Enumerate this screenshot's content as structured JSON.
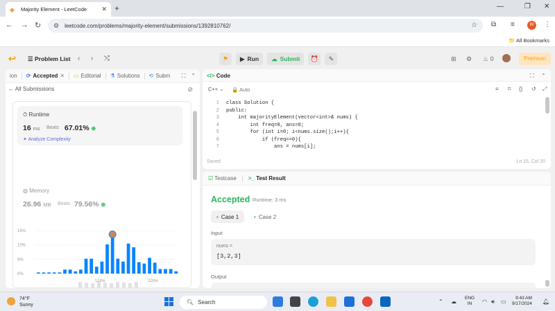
{
  "browser": {
    "tab_title": "Majority Element - LeetCode",
    "url": "leetcode.com/problems/majority-element/submissions/1392810762/",
    "bookmarks_label": "All Bookmarks"
  },
  "nav": {
    "problem_list": "Problem List",
    "run": "Run",
    "submit": "Submit",
    "streak": "0",
    "premium": "Premium"
  },
  "left": {
    "tabs": [
      "ion",
      "Accepted",
      "Editorial",
      "Solutions",
      "Subm"
    ],
    "back_label": "All Submissions",
    "runtime_label": "Runtime",
    "runtime_value": "16",
    "runtime_unit": "ms",
    "beats_label": "Beats",
    "runtime_beats": "67.01%",
    "analyze": "Analyze Complexity",
    "memory_label": "Memory",
    "memory_value": "26.96",
    "memory_unit": "MB",
    "memory_beats": "79.56%"
  },
  "chart_data": {
    "type": "bar",
    "y_ticks": [
      "15%",
      "10%",
      "5%",
      "0%"
    ],
    "x_ticks": [
      "12ms",
      "22ms"
    ],
    "ylim": [
      0,
      15
    ],
    "values": [
      0.4,
      0.4,
      0.4,
      0.4,
      0.4,
      1.4,
      1.4,
      0.8,
      1.4,
      5.2,
      5.2,
      2.4,
      4.2,
      10.2,
      12.5,
      5.2,
      4.2,
      10.5,
      9.2,
      4.0,
      3.5,
      5.5,
      3.8,
      1.6,
      1.6,
      1.6,
      0.8
    ],
    "highlight_index": 14,
    "colors": {
      "bar": "#0a84ff",
      "highlight": "#0a84ff"
    }
  },
  "code": {
    "title": "Code",
    "language": "C++",
    "mode": "Auto",
    "lines": [
      "class Solution {",
      "public:",
      "    int majorityElement(vector<int>& nums) {",
      "        int freq=0, ans=0;",
      "        for (int i=0; i<nums.size();i++){",
      "            if (freq==0){",
      "                ans = nums[i];"
    ],
    "saved": "Saved",
    "cursor": "Ln 15, Col 20"
  },
  "result": {
    "testcase_tab": "Testcase",
    "result_tab": "Test Result",
    "status": "Accepted",
    "runtime": "Runtime: 3 ms",
    "cases": [
      "Case 1",
      "Case 2"
    ],
    "input_label": "Input",
    "input_name": "nums =",
    "input_value": "[3,2,3]",
    "output_label": "Output"
  },
  "taskbar": {
    "temp": "74°F",
    "weather": "Sunny",
    "search": "Search",
    "lang1": "ENG",
    "lang2": "IN",
    "time": "9:43 AM",
    "date": "9/17/2024"
  }
}
